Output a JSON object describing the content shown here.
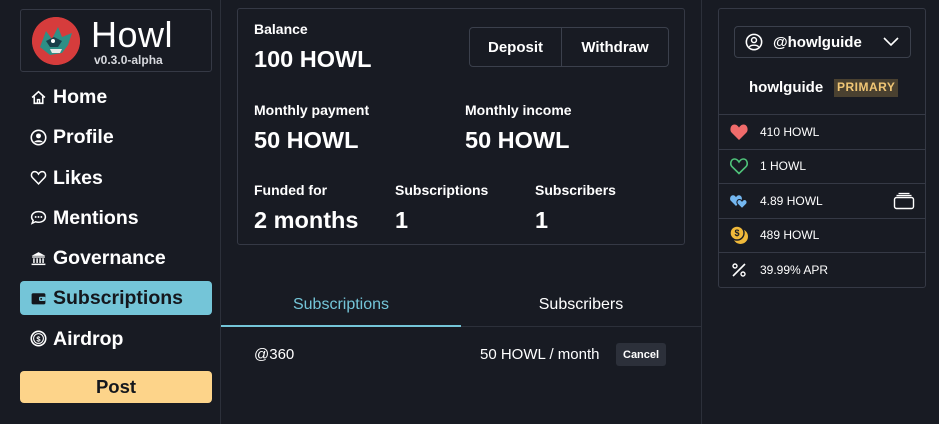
{
  "app": {
    "name": "Howl",
    "version": "v0.3.0-alpha"
  },
  "nav": {
    "items": [
      {
        "label": "Home",
        "icon": "home-icon"
      },
      {
        "label": "Profile",
        "icon": "profile-icon"
      },
      {
        "label": "Likes",
        "icon": "heart-outline-icon"
      },
      {
        "label": "Mentions",
        "icon": "chat-bubble-icon"
      },
      {
        "label": "Governance",
        "icon": "bank-icon"
      },
      {
        "label": "Subscriptions",
        "icon": "wallet-icon"
      },
      {
        "label": "Airdrop",
        "icon": "coin-icon"
      }
    ],
    "active": "Subscriptions",
    "post_label": "Post"
  },
  "balance": {
    "balance_label": "Balance",
    "balance_value": "100 HOWL",
    "deposit_label": "Deposit",
    "withdraw_label": "Withdraw",
    "monthly_payment_label": "Monthly payment",
    "monthly_payment_value": "50 HOWL",
    "monthly_income_label": "Monthly income",
    "monthly_income_value": "50 HOWL",
    "funded_for_label": "Funded for",
    "funded_for_value": "2 months",
    "subscriptions_label": "Subscriptions",
    "subscriptions_value": "1",
    "subscribers_label": "Subscribers",
    "subscribers_value": "1"
  },
  "tabs": {
    "subscriptions": "Subscriptions",
    "subscribers": "Subscribers",
    "active": "Subscriptions"
  },
  "subscriptions": [
    {
      "handle": "@360",
      "amount": "50 HOWL / month",
      "action": "Cancel"
    }
  ],
  "account": {
    "handle": "@howlguide",
    "name": "howlguide",
    "badge": "PRIMARY",
    "stats": [
      {
        "icon": "heart-filled-icon",
        "value": "410 HOWL",
        "color": "#f06b6b"
      },
      {
        "icon": "heart-outline-icon",
        "value": "1 HOWL",
        "color": "#4fc37a"
      },
      {
        "icon": "hearts-icon",
        "value": "4.89 HOWL",
        "color": "#74b7f0"
      },
      {
        "icon": "coins-icon",
        "value": "489 HOWL",
        "color": "#f0b93a"
      },
      {
        "icon": "percent-icon",
        "value": "39.99% APR",
        "color": "#ffffff"
      }
    ]
  },
  "colors": {
    "background": "#181b23",
    "accent": "#74c5d8",
    "post": "#fdd48a",
    "border": "#353945"
  }
}
